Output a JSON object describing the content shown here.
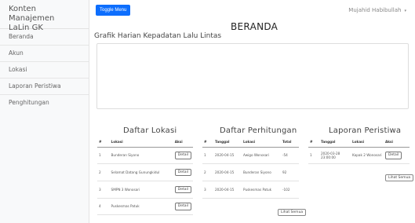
{
  "sidebar": {
    "brand_line1": "Konten Manajemen",
    "brand_line2": "LaLin GK",
    "items": [
      {
        "label": "Beranda"
      },
      {
        "label": "Akun"
      },
      {
        "label": "Lokasi"
      },
      {
        "label": "Laporan Peristiwa"
      },
      {
        "label": "Penghitungan"
      }
    ]
  },
  "topbar": {
    "toggle_label": "Toggle Menu",
    "user_name": "Mujahid Habibullah",
    "caret": "▾"
  },
  "page": {
    "title": "BERANDA",
    "chart_title": "Grafik Harian Kepadatan Lalu Lintas"
  },
  "lokasi": {
    "title": "Daftar Lokasi",
    "headers": [
      "#",
      "Lokasi",
      "Aksi"
    ],
    "rows": [
      {
        "no": "1",
        "lokasi": "Bunderan Siyono",
        "aksi": "Detail"
      },
      {
        "no": "2",
        "lokasi": "Selamat Datang Gunungkidul",
        "aksi": "Detail"
      },
      {
        "no": "3",
        "lokasi": "SMPN 3 Wonosari",
        "aksi": "Detail"
      },
      {
        "no": "4",
        "lokasi": "Puskesmas Patuk",
        "aksi": "Detail"
      }
    ]
  },
  "perhitungan": {
    "title": "Daftar Perhitungan",
    "headers": [
      "#",
      "Tanggal",
      "Lokasi",
      "Total"
    ],
    "rows": [
      {
        "no": "1",
        "tanggal": "2020-04-15",
        "lokasi": "Awigo Wonosari",
        "total": "-54"
      },
      {
        "no": "2",
        "tanggal": "2020-04-15",
        "lokasi": "Bunderan Siyono",
        "total": "92"
      },
      {
        "no": "3",
        "tanggal": "2020-04-15",
        "lokasi": "Puskesmas Patuk",
        "total": "-102"
      }
    ],
    "all_label": "Lihat Semua"
  },
  "peristiwa": {
    "title": "Laporan Peristiwa",
    "headers": [
      "#",
      "Tanggal",
      "Lokasi",
      "Aksi"
    ],
    "rows": [
      {
        "no": "1",
        "tanggal": "2020-03-28 23:00:00",
        "lokasi": "Kapak 2 Wonosari",
        "aksi": "Detail"
      }
    ],
    "all_label": "Lihat Semua"
  }
}
